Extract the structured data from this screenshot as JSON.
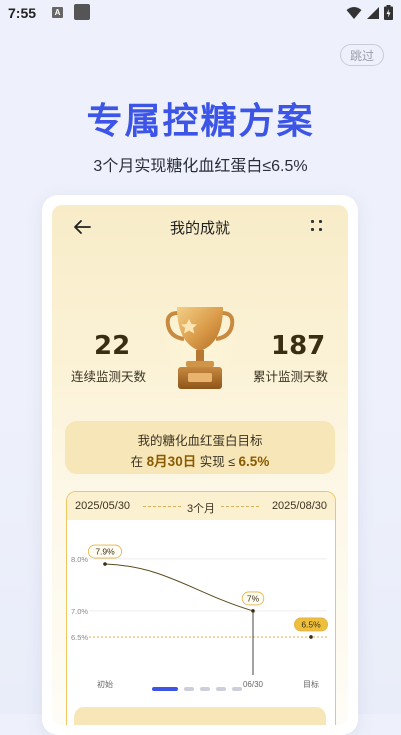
{
  "status_bar": {
    "time": "7:55",
    "notification_letter": "A"
  },
  "skip_label": "跳过",
  "headline": "专属控糖方案",
  "subline": "3个月实现糖化血红蛋白≤6.5%",
  "app": {
    "title": "我的成就",
    "stats": [
      {
        "value": "22",
        "label": "连续监测天数"
      },
      {
        "value": "187",
        "label": "累计监测天数"
      }
    ],
    "goal": {
      "title": "我的糖化血红蛋白目标",
      "prefix": "在",
      "date": "8月30日",
      "middle": "实现",
      "op": "≤",
      "target": "6.5%"
    },
    "chart_header": {
      "start": "2025/05/30",
      "period": "3个月",
      "end": "2025/08/30"
    }
  },
  "chart_data": {
    "type": "line",
    "y_ticks": [
      "8.0%",
      "7.0%",
      "6.5%"
    ],
    "x_labels": [
      "初始",
      "06/30",
      "目标"
    ],
    "points": [
      {
        "x": "初始",
        "y": 7.9,
        "label": "7.9%"
      },
      {
        "x": "06/30",
        "y": 7.0,
        "label": "7%"
      },
      {
        "x": "目标",
        "y": 6.5,
        "label": "6.5%"
      }
    ],
    "target_line": 6.5,
    "ylim": [
      6.0,
      8.4
    ]
  },
  "pager": {
    "count": 5,
    "active": 0
  },
  "colors": {
    "accent_blue": "#3c55e6",
    "gold": "#e9b73a",
    "goal_bg": "#f7e6b7"
  }
}
